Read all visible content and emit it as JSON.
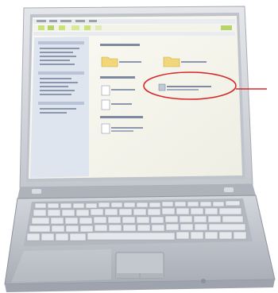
{
  "scene": {
    "subject": "laptop-with-file-explorer-screen",
    "annotation": "red-circle-callout"
  },
  "colors": {
    "background": "#ffffff",
    "chassis": "#c9ccd3",
    "chassis_shadow": "#9ea3ad",
    "screen_bezel": "#d7dae0",
    "screen_bg": "#f7f7ee",
    "sidebar_bg": "#dfe5ee",
    "folder": "#f1d77a",
    "highlight_green": "#c9e27a",
    "callout": "#d62828"
  },
  "icons": [
    "folder-icon",
    "document-icon",
    "network-icon"
  ]
}
